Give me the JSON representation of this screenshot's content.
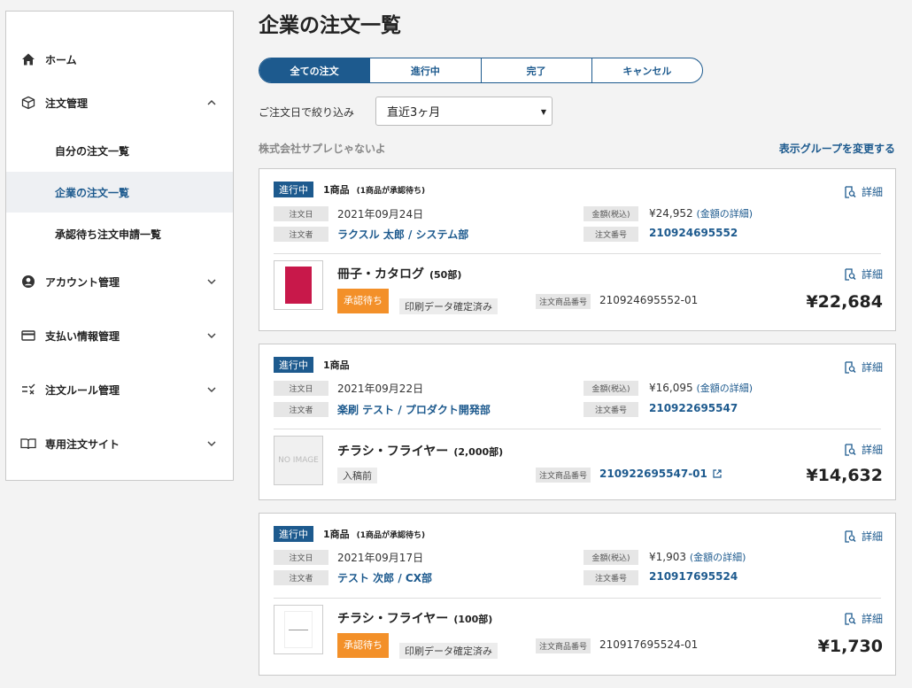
{
  "sidebar": {
    "home": "ホーム",
    "order_mgmt": "注文管理",
    "sub_items": [
      "自分の注文一覧",
      "企業の注文一覧",
      "承認待ち注文申請一覧"
    ],
    "account": "アカウント管理",
    "payment": "支払い情報管理",
    "rules": "注文ルール管理",
    "site": "専用注文サイト"
  },
  "page": {
    "title": "企業の注文一覧",
    "tabs": [
      "全ての注文",
      "進行中",
      "完了",
      "キャンセル"
    ],
    "filter_label": "ご注文日で絞り込み",
    "filter_value": "直近3ヶ月",
    "company": "株式会社サプレじゃないよ",
    "change_group": "表示グループを変更する"
  },
  "labels": {
    "order_date": "注文日",
    "orderer": "注文者",
    "amount": "金額(税込)",
    "order_no": "注文番号",
    "item_no": "注文商品番号",
    "detail": "詳細",
    "amount_detail": "(金額の詳細)"
  },
  "orders": [
    {
      "status": "進行中",
      "count": "1商品",
      "count_note": "(1商品が承認待ち)",
      "date": "2021年09月24日",
      "orderer": "ラクスル 太郎 / システム部",
      "amount": "¥24,952",
      "order_no": "210924695552",
      "product": "冊子・カタログ",
      "qty": "(50部)",
      "approval": "承認待ち",
      "state": "印刷データ確定済み",
      "item_no": "210924695552-01",
      "price": "¥22,684"
    },
    {
      "status": "進行中",
      "count": "1商品",
      "count_note": "",
      "date": "2021年09月22日",
      "orderer": "楽刷 テスト / プロダクト開発部",
      "amount": "¥16,095",
      "order_no": "210922695547",
      "product": "チラシ・フライヤー",
      "qty": "(2,000部)",
      "no_image": "NO IMAGE",
      "state": "入稿前",
      "item_no": "210922695547-01",
      "price": "¥14,632"
    },
    {
      "status": "進行中",
      "count": "1商品",
      "count_note": "(1商品が承認待ち)",
      "date": "2021年09月17日",
      "orderer": "テスト 次郎 / CX部",
      "amount": "¥1,903",
      "order_no": "210917695524",
      "product": "チラシ・フライヤー",
      "qty": "(100部)",
      "approval": "承認待ち",
      "state": "印刷データ確定済み",
      "item_no": "210917695524-01",
      "price": "¥1,730"
    }
  ]
}
